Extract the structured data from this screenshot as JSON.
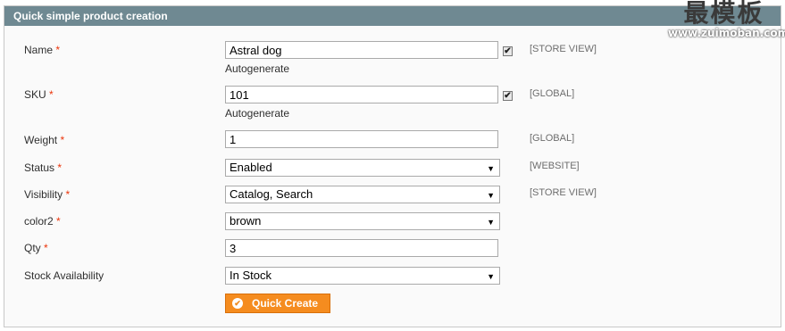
{
  "panel": {
    "title": "Quick simple product creation"
  },
  "watermark": {
    "cn_text": "最模板",
    "url_text": "www.zuimoban.com"
  },
  "required_mark": "*",
  "fields": {
    "name": {
      "label": "Name",
      "value": "Astral dog",
      "autogenerate": "Autogenerate",
      "scope": "[STORE VIEW]"
    },
    "sku": {
      "label": "SKU",
      "value": "101",
      "autogenerate": "Autogenerate",
      "scope": "[GLOBAL]"
    },
    "weight": {
      "label": "Weight",
      "value": "1",
      "scope": "[GLOBAL]"
    },
    "status": {
      "label": "Status",
      "value": "Enabled",
      "scope": "[WEBSITE]"
    },
    "visibility": {
      "label": "Visibility",
      "value": "Catalog, Search",
      "scope": "[STORE VIEW]"
    },
    "color2": {
      "label": "color2",
      "value": "brown"
    },
    "qty": {
      "label": "Qty",
      "value": "3"
    },
    "stock": {
      "label": "Stock Availability",
      "value": "In Stock"
    }
  },
  "button": {
    "label": "Quick Create"
  },
  "icons": {
    "check": "✔",
    "dropdown": "▼"
  },
  "colors": {
    "header": "#6f8992",
    "button": "#f58c1f",
    "required": "#eb340a"
  }
}
